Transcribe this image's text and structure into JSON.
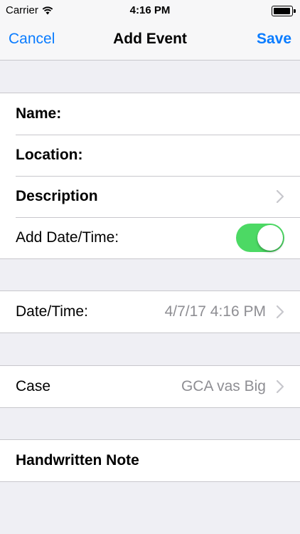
{
  "status": {
    "carrier": "Carrier",
    "time": "4:16 PM"
  },
  "nav": {
    "cancel": "Cancel",
    "title": "Add Event",
    "save": "Save"
  },
  "event_section": {
    "name_label": "Name:",
    "location_label": "Location:",
    "description_label": "Description",
    "add_datetime_label": "Add Date/Time:",
    "add_datetime_on": true
  },
  "datetime_section": {
    "label": "Date/Time:",
    "value": "4/7/17 4:16 PM"
  },
  "case_section": {
    "label": "Case",
    "value": "GCA vas Big"
  },
  "note_section": {
    "label": "Handwritten Note"
  },
  "colors": {
    "accent": "#0a7cff",
    "toggle_on": "#4cd964",
    "background": "#efeff4"
  }
}
